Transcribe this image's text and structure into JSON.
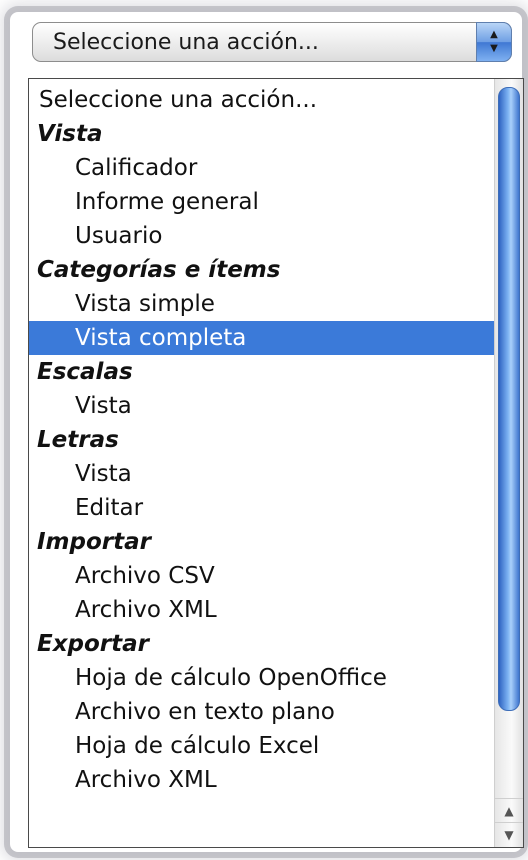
{
  "select": {
    "value": "Seleccione una acción...",
    "arrow_up": "▲",
    "arrow_down": "▼"
  },
  "menu": {
    "options": [
      {
        "label": "Seleccione una acción...",
        "kind": "top"
      },
      {
        "label": "Vista",
        "kind": "group"
      },
      {
        "label": "Calificador",
        "kind": "item"
      },
      {
        "label": "Informe general",
        "kind": "item"
      },
      {
        "label": "Usuario",
        "kind": "item"
      },
      {
        "label": "Categorías e ítems",
        "kind": "group"
      },
      {
        "label": "Vista simple",
        "kind": "item"
      },
      {
        "label": "Vista completa",
        "kind": "item",
        "selected": true
      },
      {
        "label": "Escalas",
        "kind": "group"
      },
      {
        "label": "Vista",
        "kind": "item"
      },
      {
        "label": "Letras",
        "kind": "group"
      },
      {
        "label": "Vista",
        "kind": "item"
      },
      {
        "label": "Editar",
        "kind": "item"
      },
      {
        "label": "Importar",
        "kind": "group"
      },
      {
        "label": "Archivo CSV",
        "kind": "item"
      },
      {
        "label": "Archivo XML",
        "kind": "item"
      },
      {
        "label": "Exportar",
        "kind": "group"
      },
      {
        "label": "Hoja de cálculo OpenOffice",
        "kind": "item"
      },
      {
        "label": "Archivo en texto plano",
        "kind": "item"
      },
      {
        "label": "Hoja de cálculo Excel",
        "kind": "item"
      },
      {
        "label": "Archivo XML",
        "kind": "item"
      }
    ]
  },
  "scrollbar": {
    "up_glyph": "▲",
    "down_glyph": "▼"
  },
  "colors": {
    "selection": "#3b7ad9",
    "thumb": "#4a86d8"
  }
}
